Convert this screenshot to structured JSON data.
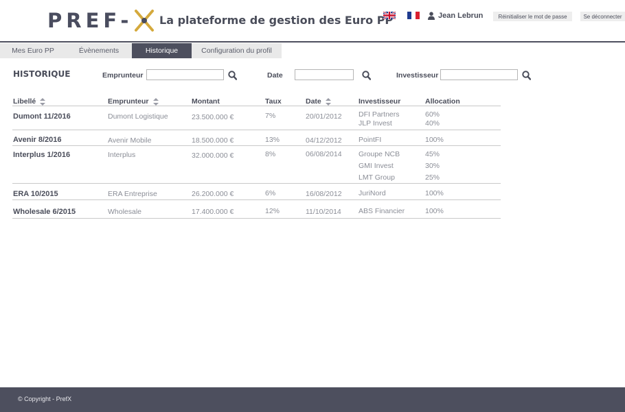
{
  "header": {
    "logo_text": "PREF-X",
    "tagline": "La plateforme de gestion des Euro PP",
    "user_name": "Jean Lebrun",
    "reset_password_label": "Réinitialiser le mot de passe",
    "logout_label": "Se déconnecter"
  },
  "tabs": [
    {
      "label": "Mes Euro PP",
      "active": false
    },
    {
      "label": "Évènements",
      "active": false
    },
    {
      "label": "Historique",
      "active": true
    },
    {
      "label": "Configuration du profil",
      "active": false
    }
  ],
  "filters": {
    "title": "HISTORIQUE",
    "emprunteur_label": "Emprunteur",
    "emprunteur_value": "",
    "date_label": "Date",
    "date_value": "",
    "investisseur_label": "Investisseur",
    "investisseur_value": ""
  },
  "table": {
    "headers": {
      "libelle": "Libellé",
      "emprunteur": "Emprunteur",
      "montant": "Montant",
      "taux": "Taux",
      "date": "Date",
      "investisseur": "Investisseur",
      "allocation": "Allocation"
    },
    "rows": [
      {
        "libelle": "Dumont 11/2016",
        "emprunteur": "Dumont Logistique",
        "montant": "23.500.000 €",
        "taux": "7%",
        "date": "20/01/2012",
        "investors": [
          {
            "name": "DFI Partners",
            "allocation": "60%"
          },
          {
            "name": "JLP Invest",
            "allocation": "40%"
          }
        ]
      },
      {
        "libelle": "Avenir 8/2016",
        "emprunteur": "Avenir Mobile",
        "montant": "18.500.000 €",
        "taux": "13%",
        "date": "04/12/2012",
        "investors": [
          {
            "name": "PointFI",
            "allocation": "100%"
          }
        ]
      },
      {
        "libelle": "Interplus 1/2016",
        "emprunteur": "Interplus",
        "montant": "32.000.000 €",
        "taux": "8%",
        "date": "06/08/2014",
        "investors": [
          {
            "name": "Groupe NCB",
            "allocation": "45%"
          },
          {
            "name": "GMI Invest",
            "allocation": "30%"
          },
          {
            "name": "LMT Group",
            "allocation": "25%"
          }
        ]
      },
      {
        "libelle": "ERA 10/2015",
        "emprunteur": "ERA Entreprise",
        "montant": "26.200.000 €",
        "taux": "6%",
        "date": "16/08/2012",
        "investors": [
          {
            "name": "JuriNord",
            "allocation": "100%"
          }
        ]
      },
      {
        "libelle": "Wholesale 6/2015",
        "emprunteur": "Wholesale",
        "montant": "17.400.000 €",
        "taux": "12%",
        "date": "11/10/2014",
        "investors": [
          {
            "name": "ABS Financier",
            "allocation": "100%"
          }
        ]
      }
    ]
  },
  "footer": {
    "copyright": "© Copyright - PrefX"
  },
  "colors": {
    "brand_dark": "#4d4f5e",
    "brand_accent": "#d4a93c",
    "tab_inactive": "#e9e9e9"
  }
}
